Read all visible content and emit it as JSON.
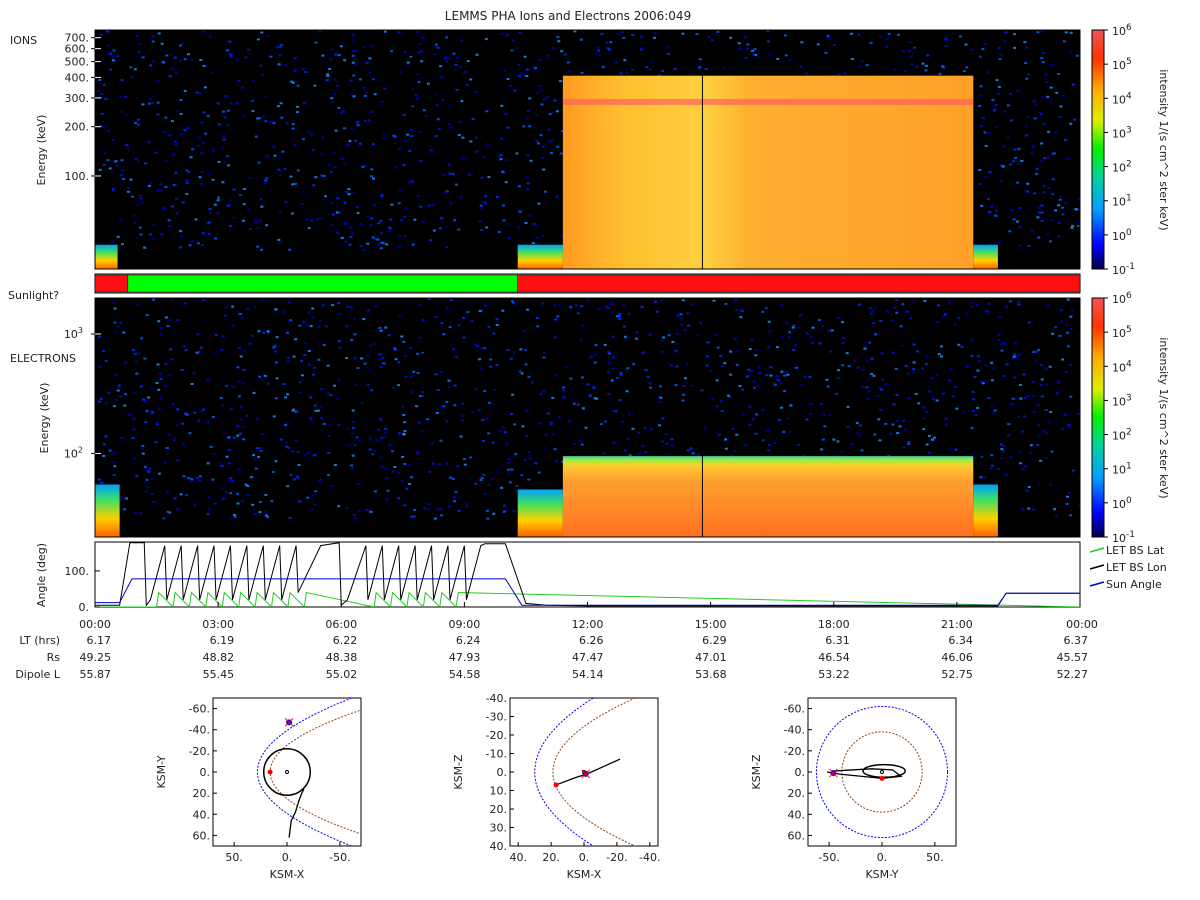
{
  "title": "LEMMS PHA Ions and Electrons  2006:049",
  "colors": {
    "background": "#000000",
    "sun_bar_dark": "#ff1010",
    "sun_bar_light": "#00ff00",
    "ions_fill": "#ffa020",
    "lat_line": "#22cc22",
    "lon_line": "#000000",
    "sun_line": "#0000cc",
    "magnetopause": "#0000ff",
    "bowshock": "#8b4513"
  },
  "chart_data": [
    {
      "type": "heatmap",
      "name": "ions",
      "panel_label": "IONS",
      "ylabel": "Energy (keV)",
      "yscale": "log",
      "ylim": [
        27,
        780
      ],
      "y_ticks": [
        100,
        200,
        300,
        400,
        500,
        600,
        700
      ],
      "y_tick_labels": [
        "100.",
        "200.",
        "300.",
        "400.",
        "500.",
        "600.",
        "700."
      ],
      "xlim": [
        0,
        24
      ],
      "colorbar": {
        "label": "intensity 1/(s cm^2 ster keV)",
        "scale": "log",
        "range": [
          0.1,
          1000000
        ],
        "ticks": [
          "10",
          "10",
          "10",
          "10",
          "10",
          "10",
          "10",
          "10"
        ],
        "exponents": [
          "-1",
          "0",
          "1",
          "2",
          "3",
          "4",
          "5",
          "6"
        ]
      },
      "regions": [
        {
          "t_start": 0.0,
          "t_end": 0.55,
          "e_low": 27,
          "e_high": 38,
          "level": "high"
        },
        {
          "t_start": 10.3,
          "t_end": 11.4,
          "e_low": 27,
          "e_high": 38,
          "level": "high"
        },
        {
          "t_start": 11.4,
          "t_end": 21.4,
          "e_low": 27,
          "e_high": 410,
          "level": "very high"
        },
        {
          "t_start": 21.4,
          "t_end": 22.0,
          "e_low": 27,
          "e_high": 38,
          "level": "high"
        }
      ]
    },
    {
      "type": "bar",
      "name": "sunlight",
      "label": "Sunlight?",
      "segments": [
        {
          "t_start": 0.0,
          "t_end": 0.8,
          "state": "dark"
        },
        {
          "t_start": 0.8,
          "t_end": 10.3,
          "state": "light"
        },
        {
          "t_start": 10.3,
          "t_end": 24.0,
          "state": "dark"
        }
      ]
    },
    {
      "type": "heatmap",
      "name": "electrons",
      "panel_label": "ELECTRONS",
      "ylabel": "Energy (keV)",
      "yscale": "log",
      "ylim": [
        20,
        2000
      ],
      "y_ticks": [
        100,
        1000
      ],
      "y_tick_labels": [
        "10",
        "10"
      ],
      "y_tick_exponents": [
        "2",
        "3"
      ],
      "xlim": [
        0,
        24
      ],
      "colorbar": {
        "label": "intensity 1/(s cm^2 ster keV)",
        "scale": "log",
        "range": [
          0.1,
          1000000
        ],
        "ticks": [
          "10",
          "10",
          "10",
          "10",
          "10",
          "10",
          "10",
          "10"
        ],
        "exponents": [
          "-1",
          "0",
          "1",
          "2",
          "3",
          "4",
          "5",
          "6"
        ]
      },
      "regions": [
        {
          "t_start": 0.0,
          "t_end": 0.6,
          "e_low": 20,
          "e_high": 55,
          "level": "high"
        },
        {
          "t_start": 10.3,
          "t_end": 11.4,
          "e_low": 20,
          "e_high": 50,
          "level": "high"
        },
        {
          "t_start": 11.4,
          "t_end": 21.4,
          "e_low": 20,
          "e_high": 95,
          "level": "very high"
        },
        {
          "t_start": 21.4,
          "t_end": 22.0,
          "e_low": 20,
          "e_high": 55,
          "level": "high"
        }
      ]
    },
    {
      "type": "line",
      "name": "angles",
      "ylabel": "Angle (deg)",
      "ylim": [
        0,
        180
      ],
      "y_ticks": [
        0,
        100
      ],
      "y_tick_labels": [
        "0.",
        "100."
      ],
      "xlim": [
        0,
        24
      ],
      "x_ticks": [
        0,
        3,
        6,
        9,
        12,
        15,
        18,
        21,
        24
      ],
      "x_tick_labels": [
        "00:00",
        "03:00",
        "06:00",
        "09:00",
        "12:00",
        "15:00",
        "18:00",
        "21:00",
        "00:00"
      ],
      "legend_position": "right",
      "series": [
        {
          "name": "LET BS Lat",
          "color": "#22cc22",
          "x": [
            0,
            1.5,
            1.55,
            1.9,
            1.95,
            2.3,
            2.35,
            2.7,
            2.75,
            3.1,
            3.15,
            3.5,
            3.55,
            3.9,
            3.95,
            4.3,
            4.35,
            4.7,
            4.75,
            5.1,
            5.15,
            6.8,
            6.85,
            7.2,
            7.25,
            7.6,
            7.65,
            8.0,
            8.05,
            8.4,
            8.45,
            8.8,
            8.85,
            24
          ],
          "y": [
            0,
            0,
            40,
            0,
            40,
            0,
            40,
            0,
            40,
            0,
            40,
            0,
            40,
            0,
            40,
            0,
            40,
            0,
            40,
            0,
            40,
            0,
            40,
            0,
            40,
            0,
            40,
            0,
            40,
            0,
            40,
            0,
            40,
            0
          ]
        },
        {
          "name": "LET BS Lon",
          "color": "#000000",
          "x": [
            0,
            0.6,
            0.85,
            1.2,
            1.25,
            1.35,
            1.7,
            1.75,
            2.1,
            2.15,
            2.5,
            2.55,
            2.9,
            2.95,
            3.3,
            3.35,
            3.7,
            3.75,
            4.1,
            4.15,
            4.5,
            4.55,
            4.9,
            4.95,
            5.5,
            5.95,
            6.0,
            6.15,
            6.6,
            6.65,
            7.0,
            7.05,
            7.4,
            7.45,
            7.8,
            7.85,
            8.2,
            8.25,
            8.6,
            8.65,
            9.0,
            9.05,
            9.4,
            9.5,
            10.0,
            10.5,
            11.0,
            12.0,
            22.0,
            22.2,
            24.0
          ],
          "y": [
            5,
            5,
            178,
            178,
            5,
            20,
            170,
            20,
            170,
            20,
            170,
            20,
            170,
            20,
            170,
            20,
            170,
            20,
            170,
            20,
            170,
            20,
            170,
            40,
            170,
            178,
            5,
            20,
            170,
            20,
            170,
            20,
            170,
            20,
            170,
            20,
            170,
            20,
            170,
            20,
            170,
            20,
            170,
            175,
            175,
            10,
            5,
            3,
            3,
            38,
            38
          ]
        },
        {
          "name": "Sun Angle",
          "color": "#0000cc",
          "x": [
            0,
            0.6,
            0.9,
            10.0,
            10.4,
            11.5,
            22.0,
            22.2,
            24.0
          ],
          "y": [
            12,
            12,
            78,
            78,
            5,
            5,
            5,
            38,
            38
          ]
        }
      ]
    },
    {
      "type": "table",
      "name": "ephemeris",
      "rows": [
        {
          "label": "LT (hrs)",
          "values": [
            "6.17",
            "6.19",
            "6.22",
            "6.24",
            "6.26",
            "6.29",
            "6.31",
            "6.34",
            "6.37"
          ]
        },
        {
          "label": "Rs",
          "values": [
            "49.25",
            "48.82",
            "48.38",
            "47.93",
            "47.47",
            "47.01",
            "46.54",
            "46.06",
            "45.57"
          ]
        },
        {
          "label": "Dipole L",
          "values": [
            "55.87",
            "55.45",
            "55.02",
            "54.58",
            "54.14",
            "53.68",
            "53.22",
            "52.75",
            "52.27"
          ]
        }
      ]
    },
    {
      "type": "scatter",
      "name": "orbit-xy",
      "xlabel": "KSM-X",
      "ylabel": "KSM-Y",
      "xlim": [
        70,
        -70
      ],
      "ylim": [
        -70,
        70
      ],
      "x_ticks": [
        50,
        0,
        -50
      ],
      "x_tick_labels": [
        "50.",
        "0.",
        "-50."
      ],
      "y_ticks": [
        -60,
        -40,
        -20,
        0,
        20,
        40,
        60
      ],
      "y_tick_labels": [
        "-60.",
        "-40.",
        "-20.",
        "0.",
        "20.",
        "40.",
        "60."
      ],
      "orbit": {
        "x": [
          -2,
          -4,
          -8,
          -11,
          -14,
          -16
        ],
        "y": [
          62,
          46,
          38,
          28,
          20,
          16
        ]
      },
      "current_position": [
        -2,
        -47
      ],
      "highlight": [
        16,
        0
      ]
    },
    {
      "type": "scatter",
      "name": "orbit-xz",
      "xlabel": "KSM-X",
      "ylabel": "KSM-Z",
      "xlim": [
        45,
        -45
      ],
      "ylim": [
        -40,
        40
      ],
      "x_ticks": [
        40,
        20,
        0,
        -20,
        -40
      ],
      "x_tick_labels": [
        "40.",
        "20.",
        "0.",
        "-20.",
        "-40."
      ],
      "y_ticks": [
        -40,
        -30,
        -20,
        -10,
        0,
        10,
        20,
        30,
        40
      ],
      "y_tick_labels": [
        "-40.",
        "-30.",
        "-20.",
        "-10.",
        "0.",
        "10.",
        "20.",
        "30.",
        "40."
      ],
      "orbit": {
        "x": [
          17,
          5,
          -2,
          -12,
          -22
        ],
        "y": [
          7,
          3,
          1,
          -3,
          -7
        ]
      },
      "current_position": [
        -1,
        1
      ],
      "highlight": [
        17,
        7
      ]
    },
    {
      "type": "scatter",
      "name": "orbit-yz",
      "xlabel": "KSM-Y",
      "ylabel": "KSM-Z",
      "xlim": [
        -70,
        70
      ],
      "ylim": [
        -70,
        70
      ],
      "x_ticks": [
        -50,
        0,
        50
      ],
      "x_tick_labels": [
        "-50.",
        "0.",
        "50."
      ],
      "y_ticks": [
        -60,
        -40,
        -20,
        0,
        20,
        40,
        60
      ],
      "y_tick_labels": [
        "-60.",
        "-40.",
        "-20.",
        "0.",
        "20.",
        "40.",
        "60."
      ],
      "orbit": {
        "x": [
          -52,
          -40,
          -20,
          0,
          18,
          10,
          -10,
          -45
        ],
        "y": [
          0,
          2,
          4,
          6,
          4,
          -2,
          -3,
          -1
        ]
      },
      "current_position": [
        -46,
        1
      ],
      "highlight": [
        0,
        6
      ]
    }
  ]
}
